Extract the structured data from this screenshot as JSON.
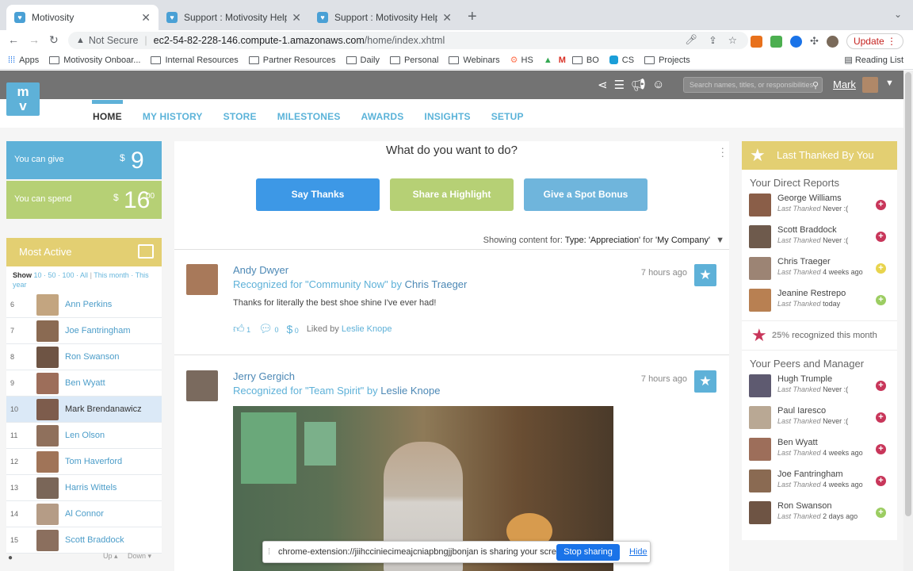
{
  "browser": {
    "tabs": [
      {
        "title": "Motivosity",
        "active": true
      },
      {
        "title": "Support : Motivosity Help Cent",
        "active": false
      },
      {
        "title": "Support : Motivosity Help Cent",
        "active": false
      }
    ],
    "not_secure": "Not Secure",
    "url_host": "ec2-54-82-228-146.compute-1.amazonaws.com",
    "url_path": "/home/index.xhtml",
    "update_label": "Update",
    "bookmarks": [
      "Apps",
      "Motivosity Onboar...",
      "Internal Resources",
      "Partner Resources",
      "Daily",
      "Personal",
      "Webinars",
      "HS",
      "BO",
      "CS",
      "Projects"
    ],
    "reading_list": "Reading List"
  },
  "app": {
    "logo": "m\nv",
    "search_placeholder": "Search names, titles, or responsibilities",
    "user_name": "Mark",
    "nav": [
      "HOME",
      "MY HISTORY",
      "STORE",
      "MILESTONES",
      "AWARDS",
      "INSIGHTS",
      "SETUP"
    ]
  },
  "wallet": {
    "give_label": "You can give",
    "give_currency": "$",
    "give_amount": "9",
    "spend_label": "You can spend",
    "spend_currency": "$",
    "spend_amount": "16",
    "spend_cents": "00"
  },
  "most_active": {
    "title": "Most Active",
    "show_label": "Show",
    "filters_counts": "10 · 50 · 100 · All",
    "filters_time": "This month · This year",
    "rows": [
      {
        "rank": "6",
        "name": "Ann Perkins"
      },
      {
        "rank": "7",
        "name": "Joe Fantringham"
      },
      {
        "rank": "8",
        "name": "Ron Swanson"
      },
      {
        "rank": "9",
        "name": "Ben Wyatt"
      },
      {
        "rank": "10",
        "name": "Mark Brendanawicz"
      },
      {
        "rank": "11",
        "name": "Len Olson"
      },
      {
        "rank": "12",
        "name": "Tom Haverford"
      },
      {
        "rank": "13",
        "name": "Harris Wittels"
      },
      {
        "rank": "14",
        "name": "Al Connor"
      },
      {
        "rank": "15",
        "name": "Scott Braddock"
      }
    ],
    "up_label": "Up",
    "down_label": "Down"
  },
  "feed": {
    "question": "What do you want to do?",
    "buttons": [
      "Say Thanks",
      "Share a Highlight",
      "Give a Spot Bonus"
    ],
    "showing_prefix": "Showing content for:",
    "showing_type": "Type: 'Appreciation'",
    "showing_for": "for",
    "showing_company": "'My Company'",
    "posts": [
      {
        "name": "Andy Dwyer",
        "recognized": "Recognized for \"Community Now\" by",
        "by": "Chris Traeger",
        "time": "7 hours ago",
        "message": "Thanks for literally the best shoe shine I've ever had!",
        "likes": "1",
        "comments": "0",
        "bonus": "0",
        "liked_by_label": "Liked by",
        "liked_by": "Leslie Knope"
      },
      {
        "name": "Jerry Gergich",
        "recognized": "Recognized for \"Team Spirit\" by",
        "by": "Leslie Knope",
        "time": "7 hours ago"
      }
    ]
  },
  "share_bar": {
    "text": "chrome-extension://jiihcciniecimeajcniapbngjjbonjan is sharing your screen.",
    "stop": "Stop sharing",
    "hide": "Hide"
  },
  "right": {
    "last_thanked_title": "Last Thanked By You",
    "direct_reports_title": "Your Direct Reports",
    "last_thanked_label": "Last Thanked",
    "direct_reports": [
      {
        "name": "George Williams",
        "when": "Never :(",
        "status": "red"
      },
      {
        "name": "Scott Braddock",
        "when": "Never :(",
        "status": "red"
      },
      {
        "name": "Chris Traeger",
        "when": "4 weeks ago",
        "status": "yellow"
      },
      {
        "name": "Jeanine Restrepo",
        "when": "today",
        "status": "green"
      }
    ],
    "recognized_pct": "25%",
    "recognized_text": "recognized this month",
    "peers_title": "Your Peers and Manager",
    "peers": [
      {
        "name": "Hugh Trumple",
        "when": "Never :(",
        "status": "red"
      },
      {
        "name": "Paul Iaresco",
        "when": "Never :(",
        "status": "red"
      },
      {
        "name": "Ben Wyatt",
        "when": "4 weeks ago",
        "status": "red"
      },
      {
        "name": "Joe Fantringham",
        "when": "4 weeks ago",
        "status": "red"
      },
      {
        "name": "Ron Swanson",
        "when": "2 days ago",
        "status": "green"
      }
    ]
  },
  "colors": {
    "accent": "#5eb1d8",
    "gold": "#e3cf72",
    "green": "#b6d075",
    "red": "#c8365a",
    "yellow": "#e8d44d"
  }
}
